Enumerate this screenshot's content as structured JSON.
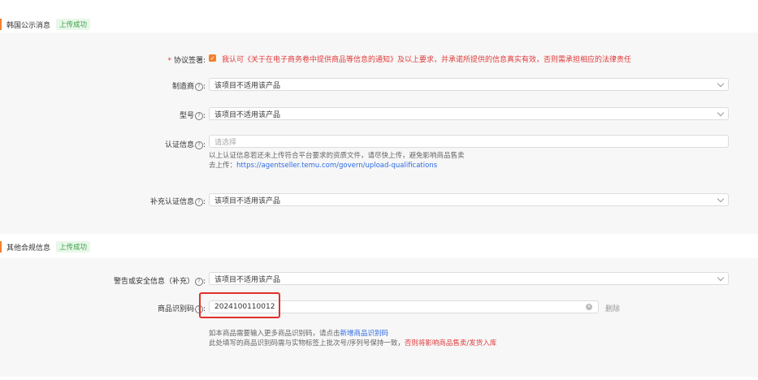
{
  "section1": {
    "title": "韩国公示消息",
    "badge": "上传成功",
    "agreement": {
      "label": "协议签署",
      "text": "我认可《关于在电子商务卷中提供商品等信息的通知》及以上要求，并承诺所提供的信息真实有效，否则需承担相应的法律责任"
    },
    "manufacturer": {
      "label": "制造商",
      "value": "该项目不适用该产品"
    },
    "model": {
      "label": "型号",
      "value": "该项目不适用该产品"
    },
    "certification": {
      "label": "认证信息",
      "placeholder": "请选择",
      "note_line1": "以上认证信息若还未上传符合平台要求的资质文件，请尽快上传，避免影响商品售卖",
      "note_prefix": "去上传：",
      "note_link": "https://agentseller.temu.com/govern/upload-qualifications"
    },
    "extra_cert": {
      "label": "补充认证信息",
      "value": "该项目不适用该产品"
    }
  },
  "section2": {
    "title": "其他合规信息",
    "badge": "上传成功",
    "warning": {
      "label": "警告或安全信息（补充）",
      "value": "该项目不适用该产品"
    },
    "product_code": {
      "label": "商品识别码",
      "value": "2024100110012",
      "delete_label": "删除",
      "note_line1_prefix": "如本商品需要输入更多商品识别码，请点击",
      "note_line1_link": "新增商品识别码",
      "note_line2_prefix": "此处填写的商品识别码需与实物标签上批次号/序列号保持一致，",
      "note_line2_red": "否则将影响商品售卖/发货入库"
    }
  },
  "colors": {
    "accent": "#f5802d",
    "success": "#3aa14a",
    "danger": "#e03b3b",
    "link": "#2f6be3"
  },
  "icons": [
    "question-icon",
    "chevron-down-icon",
    "check-icon",
    "clear-icon"
  ],
  "question_glyph": "?"
}
